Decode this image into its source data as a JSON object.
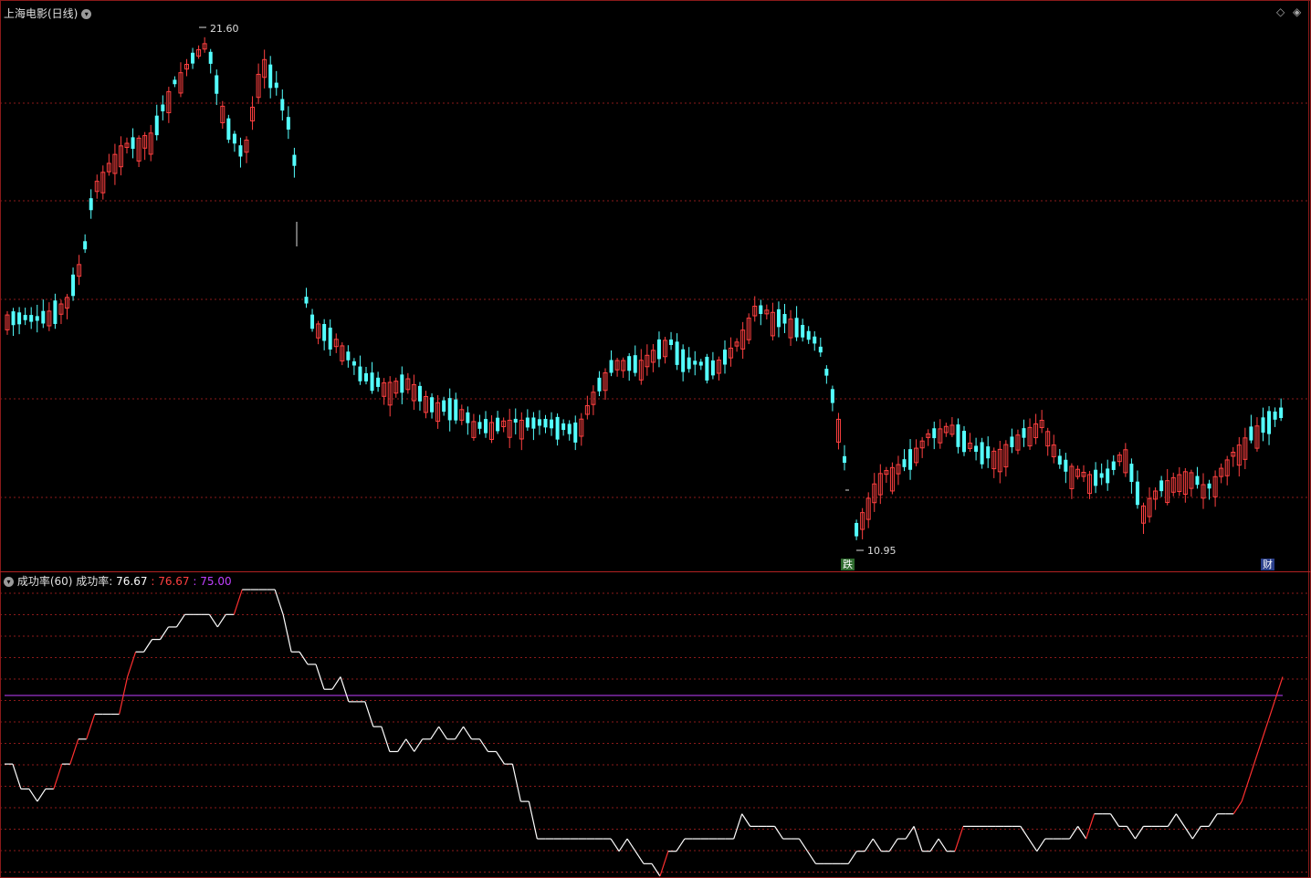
{
  "header": {
    "title": "上海电影(日线)",
    "indicator_name": "成功率(60)",
    "indicator_label": "成功率:",
    "indicator_value_white": "76.67",
    "indicator_value_red": ": 76.67",
    "indicator_value_purple": ": 75.00"
  },
  "badges": {
    "drop_badge": "跌",
    "finance_badge": "财"
  },
  "colors": {
    "up": "#ff4040",
    "down": "#54ffff",
    "grid": "#8b1a1a",
    "line_white": "#ffffff",
    "line_red": "#ff3030",
    "threshold": "#c040ff"
  },
  "chart_data": [
    {
      "type": "candlestick",
      "title": "上海电影(日线)",
      "annotations": [
        {
          "label": "21.60",
          "value": 21.6
        },
        {
          "label": "10.95",
          "value": 10.95
        }
      ],
      "ylim": [
        10.7,
        21.9
      ],
      "grid": true
    },
    {
      "type": "line",
      "title": "成功率(60)",
      "series": [
        {
          "name": "成功率"
        }
      ],
      "threshold": 75.0,
      "last_value": 76.67,
      "values": [
        64,
        64,
        60,
        60,
        58,
        60,
        60,
        64,
        64,
        68,
        68,
        72,
        72,
        72,
        72,
        78,
        82,
        82,
        84,
        84,
        86,
        86,
        88,
        88,
        88,
        88,
        86,
        88,
        88,
        92,
        92,
        92,
        92,
        92,
        88,
        82,
        82,
        80,
        80,
        76,
        76,
        78,
        74,
        74,
        74,
        70,
        70,
        66,
        66,
        68,
        66,
        68,
        68,
        70,
        68,
        68,
        70,
        68,
        68,
        66,
        66,
        64,
        64,
        58,
        58,
        52,
        52,
        52,
        52,
        52,
        52,
        52,
        52,
        52,
        52,
        50,
        52,
        50,
        48,
        48,
        46,
        50,
        50,
        52,
        52,
        52,
        52,
        52,
        52,
        52,
        56,
        54,
        54,
        54,
        54,
        52,
        52,
        52,
        50,
        48,
        48,
        48,
        48,
        48,
        50,
        50,
        52,
        50,
        50,
        52,
        52,
        54,
        50,
        50,
        52,
        50,
        50,
        54,
        54,
        54,
        54,
        54,
        54,
        54,
        54,
        52,
        50,
        52,
        52,
        52,
        52,
        54,
        52,
        56,
        56,
        56,
        54,
        54,
        52,
        54,
        54,
        54,
        54,
        56,
        54,
        52,
        54,
        54,
        56,
        56,
        56,
        58,
        62,
        66,
        70,
        74,
        78
      ]
    }
  ]
}
